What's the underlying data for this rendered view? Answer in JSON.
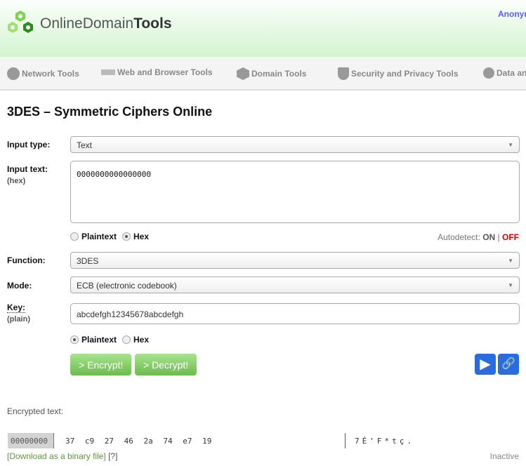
{
  "header": {
    "logo_light": "OnlineDomain",
    "logo_bold": "Tools",
    "user": "Anonym"
  },
  "nav": [
    {
      "label": "Network Tools",
      "icon": "globe-icon"
    },
    {
      "label": "Web and Browser Tools",
      "icon": "www-icon"
    },
    {
      "label": "Domain Tools",
      "icon": "hexagon-icon"
    },
    {
      "label": "Security and Privacy Tools",
      "icon": "shield-icon"
    },
    {
      "label": "Data an",
      "icon": "gears-icon"
    }
  ],
  "page_title": "3DES – Symmetric Ciphers Online",
  "form": {
    "input_type": {
      "label": "Input type:",
      "value": "Text"
    },
    "input_text": {
      "label": "Input text:",
      "sub": "(hex)",
      "value": "0000000000000000",
      "radio_plain": "Plaintext",
      "radio_hex": "Hex",
      "selected": "Hex",
      "autodetect": "Autodetect:",
      "on": "ON",
      "sep": "|",
      "off": "OFF"
    },
    "function": {
      "label": "Function:",
      "value": "3DES"
    },
    "mode": {
      "label": "Mode:",
      "value": "ECB (electronic codebook)"
    },
    "key": {
      "label": "Key:",
      "sub": "(plain)",
      "value": "abcdefgh12345678abcdefgh",
      "radio_plain": "Plaintext",
      "radio_hex": "Hex",
      "selected": "Plaintext"
    },
    "encrypt": "> Encrypt!",
    "decrypt": "> Decrypt!"
  },
  "output": {
    "label": "Encrypted text:",
    "offset": "00000000",
    "bytes": "37 c9 27 46 2a 74 e7 19",
    "chars": "7É'F*tç.",
    "download": "[Download as a binary file]",
    "help": "[?]",
    "status": "Inactive"
  },
  "colors": {
    "accent_green": "#6dbb4e",
    "off_red": "#e00000",
    "blue": "#2a6ce0"
  }
}
